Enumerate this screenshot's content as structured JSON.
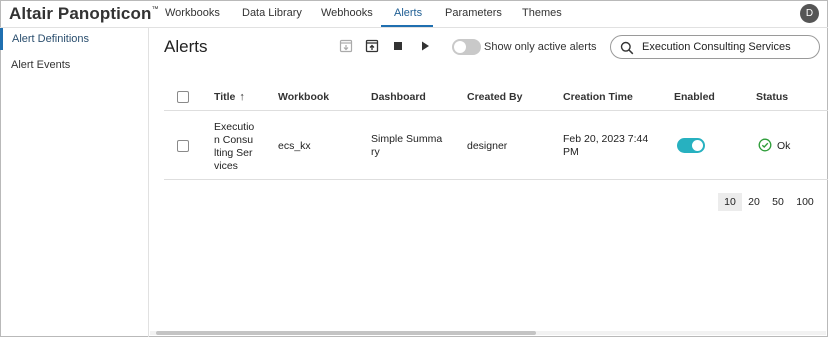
{
  "app": {
    "brand": "Altair Panopticon",
    "trademark": "™",
    "user_initial": "D"
  },
  "nav": {
    "items": [
      {
        "label": "Workbooks"
      },
      {
        "label": "Data Library"
      },
      {
        "label": "Webhooks"
      },
      {
        "label": "Alerts",
        "active": true
      },
      {
        "label": "Parameters"
      },
      {
        "label": "Themes"
      }
    ]
  },
  "sidebar": {
    "items": [
      {
        "label": "Alert Definitions",
        "active": true
      },
      {
        "label": "Alert Events"
      }
    ]
  },
  "main": {
    "title": "Alerts",
    "toolbar": {
      "icons": [
        "import-icon",
        "export-icon",
        "stop-icon",
        "play-icon"
      ],
      "toggle_label": "Show only active alerts",
      "toggle_on": false
    },
    "search": {
      "value": "Execution Consulting Services"
    },
    "table": {
      "columns": [
        "Title",
        "Workbook",
        "Dashboard",
        "Created By",
        "Creation Time",
        "Enabled",
        "Status"
      ],
      "sort_indicator": "↑",
      "rows": [
        {
          "title_lines": [
            "Executio",
            "n Consu",
            "lting Ser",
            "vices"
          ],
          "workbook": "ecs_kx",
          "dashboard_lines": [
            "Simple Summa",
            "ry"
          ],
          "created_by": "designer",
          "creation_time_lines": [
            "Feb 20, 2023 7:44",
            "PM"
          ],
          "enabled": true,
          "status": "Ok"
        }
      ]
    },
    "pagination": {
      "sizes": [
        "10",
        "20",
        "50",
        "100"
      ],
      "selected": "10"
    }
  },
  "colors": {
    "accent": "#1f6fb0",
    "toggle_on": "#27b1c0",
    "status_ok": "#2e9d3a"
  }
}
